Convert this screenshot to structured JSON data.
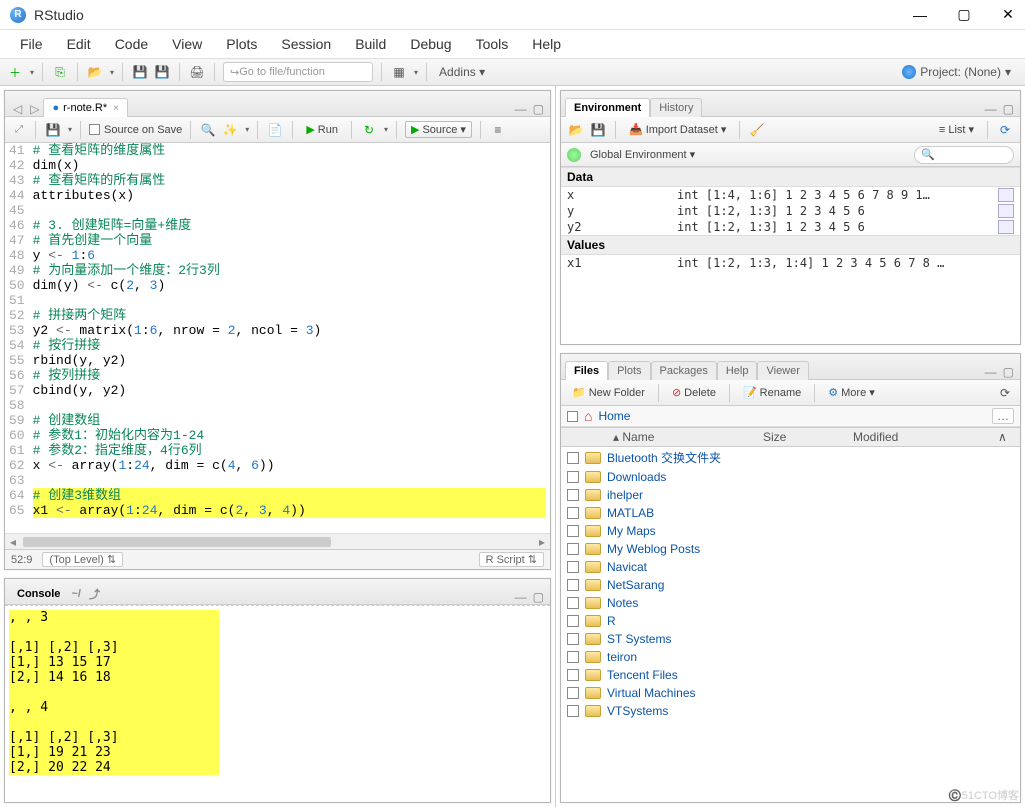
{
  "window": {
    "title": "RStudio"
  },
  "menu": [
    "File",
    "Edit",
    "Code",
    "View",
    "Plots",
    "Session",
    "Build",
    "Debug",
    "Tools",
    "Help"
  ],
  "toolbar": {
    "goto_placeholder": "Go to file/function",
    "addins": "Addins",
    "project": "Project: (None)"
  },
  "editor": {
    "tab": "r-note.R*",
    "sourceOnSave": "Source on Save",
    "run": "Run",
    "source": "Source",
    "status_pos": "52:9",
    "status_level": "(Top Level)",
    "status_lang": "R Script",
    "lines": [
      {
        "n": 41,
        "seg": [
          {
            "c": "c-comment",
            "t": "# 查看矩阵的维度属性"
          }
        ]
      },
      {
        "n": 42,
        "seg": [
          {
            "c": "",
            "t": "dim(x)"
          }
        ]
      },
      {
        "n": 43,
        "seg": [
          {
            "c": "c-comment",
            "t": "# 查看矩阵的所有属性"
          }
        ]
      },
      {
        "n": 44,
        "seg": [
          {
            "c": "",
            "t": "attributes(x)"
          }
        ]
      },
      {
        "n": 45,
        "seg": [
          {
            "c": "",
            "t": ""
          }
        ]
      },
      {
        "n": 46,
        "seg": [
          {
            "c": "c-comment",
            "t": "# 3. 创建矩阵=向量+维度"
          }
        ]
      },
      {
        "n": 47,
        "seg": [
          {
            "c": "c-comment",
            "t": "# 首先创建一个向量"
          }
        ]
      },
      {
        "n": 48,
        "seg": [
          {
            "c": "",
            "t": "y "
          },
          {
            "c": "c-op",
            "t": "<- "
          },
          {
            "c": "c-num",
            "t": "1"
          },
          {
            "c": "",
            "t": ":"
          },
          {
            "c": "c-num",
            "t": "6"
          }
        ]
      },
      {
        "n": 49,
        "seg": [
          {
            "c": "c-comment",
            "t": "# 为向量添加一个维度：2行3列"
          }
        ]
      },
      {
        "n": 50,
        "seg": [
          {
            "c": "",
            "t": "dim(y) "
          },
          {
            "c": "c-op",
            "t": "<- "
          },
          {
            "c": "",
            "t": "c("
          },
          {
            "c": "c-num",
            "t": "2"
          },
          {
            "c": "",
            "t": ", "
          },
          {
            "c": "c-num",
            "t": "3"
          },
          {
            "c": "",
            "t": ")"
          }
        ]
      },
      {
        "n": 51,
        "seg": [
          {
            "c": "",
            "t": ""
          }
        ]
      },
      {
        "n": 52,
        "seg": [
          {
            "c": "c-comment",
            "t": "# 拼接两个矩阵"
          }
        ]
      },
      {
        "n": 53,
        "seg": [
          {
            "c": "",
            "t": "y2 "
          },
          {
            "c": "c-op",
            "t": "<- "
          },
          {
            "c": "",
            "t": "matrix("
          },
          {
            "c": "c-num",
            "t": "1"
          },
          {
            "c": "",
            "t": ":"
          },
          {
            "c": "c-num",
            "t": "6"
          },
          {
            "c": "",
            "t": ", nrow = "
          },
          {
            "c": "c-num",
            "t": "2"
          },
          {
            "c": "",
            "t": ", ncol = "
          },
          {
            "c": "c-num",
            "t": "3"
          },
          {
            "c": "",
            "t": ")"
          }
        ]
      },
      {
        "n": 54,
        "seg": [
          {
            "c": "c-comment",
            "t": "# 按行拼接"
          }
        ]
      },
      {
        "n": 55,
        "seg": [
          {
            "c": "",
            "t": "rbind(y, y2)"
          }
        ]
      },
      {
        "n": 56,
        "seg": [
          {
            "c": "c-comment",
            "t": "# 按列拼接"
          }
        ]
      },
      {
        "n": 57,
        "seg": [
          {
            "c": "",
            "t": "cbind(y, y2)"
          }
        ]
      },
      {
        "n": 58,
        "seg": [
          {
            "c": "",
            "t": ""
          }
        ]
      },
      {
        "n": 59,
        "seg": [
          {
            "c": "c-comment",
            "t": "# 创建数组"
          }
        ]
      },
      {
        "n": 60,
        "seg": [
          {
            "c": "c-comment",
            "t": "# 参数1：初始化内容为1-24"
          }
        ]
      },
      {
        "n": 61,
        "seg": [
          {
            "c": "c-comment",
            "t": "# 参数2：指定维度，4行6列"
          }
        ]
      },
      {
        "n": 62,
        "seg": [
          {
            "c": "",
            "t": "x "
          },
          {
            "c": "c-op",
            "t": "<- "
          },
          {
            "c": "",
            "t": "array("
          },
          {
            "c": "c-num",
            "t": "1"
          },
          {
            "c": "",
            "t": ":"
          },
          {
            "c": "c-num",
            "t": "24"
          },
          {
            "c": "",
            "t": ", dim = c("
          },
          {
            "c": "c-num",
            "t": "4"
          },
          {
            "c": "",
            "t": ", "
          },
          {
            "c": "c-num",
            "t": "6"
          },
          {
            "c": "",
            "t": "))"
          }
        ]
      },
      {
        "n": 63,
        "seg": [
          {
            "c": "",
            "t": ""
          }
        ]
      },
      {
        "n": 64,
        "hl": true,
        "seg": [
          {
            "c": "c-comment",
            "t": "# 创建3维数组"
          }
        ]
      },
      {
        "n": 65,
        "hl": true,
        "seg": [
          {
            "c": "",
            "t": "x1 "
          },
          {
            "c": "c-op",
            "t": "<- "
          },
          {
            "c": "",
            "t": "array("
          },
          {
            "c": "c-num",
            "t": "1"
          },
          {
            "c": "",
            "t": ":"
          },
          {
            "c": "c-num",
            "t": "24"
          },
          {
            "c": "",
            "t": ", dim = c("
          },
          {
            "c": "c-num",
            "t": "2"
          },
          {
            "c": "",
            "t": ", "
          },
          {
            "c": "c-num",
            "t": "3"
          },
          {
            "c": "",
            "t": ", "
          },
          {
            "c": "c-num",
            "t": "4"
          },
          {
            "c": "",
            "t": "))"
          }
        ]
      }
    ]
  },
  "console": {
    "title": "Console",
    "path": "~/",
    "lines": [
      ", , 3",
      "",
      "     [,1] [,2] [,3]",
      "[1,]   13   15   17",
      "[2,]   14   16   18",
      "",
      ", , 4",
      "",
      "     [,1] [,2] [,3]",
      "[1,]   19   21   23",
      "[2,]   20   22   24"
    ]
  },
  "env": {
    "tabs": [
      "Environment",
      "History"
    ],
    "importLabel": "Import Dataset",
    "listLabel": "List",
    "scopeLabel": "Global Environment",
    "sections": [
      {
        "header": "Data",
        "rows": [
          {
            "name": "x",
            "value": "int [1:4, 1:6] 1 2 3 4 5 6 7 8 9 1…",
            "grid": true
          },
          {
            "name": "y",
            "value": "int [1:2, 1:3] 1 2 3 4 5 6",
            "grid": true
          },
          {
            "name": "y2",
            "value": "int [1:2, 1:3] 1 2 3 4 5 6",
            "grid": true
          }
        ]
      },
      {
        "header": "Values",
        "rows": [
          {
            "name": "x1",
            "value": "int [1:2, 1:3, 1:4] 1 2 3 4 5 6 7 8 …",
            "grid": false
          }
        ]
      }
    ]
  },
  "files": {
    "tabs": [
      "Files",
      "Plots",
      "Packages",
      "Help",
      "Viewer"
    ],
    "newFolder": "New Folder",
    "delete": "Delete",
    "rename": "Rename",
    "more": "More",
    "home": "Home",
    "cols": {
      "name": "Name",
      "size": "Size",
      "modified": "Modified"
    },
    "items": [
      "Bluetooth 交换文件夹",
      "Downloads",
      "ihelper",
      "MATLAB",
      "My Maps",
      "My Weblog Posts",
      "Navicat",
      "NetSarang",
      "Notes",
      "R",
      "ST Systems",
      "teiron",
      "Tencent Files",
      "Virtual Machines",
      "VTSystems"
    ]
  },
  "watermark": "©️51CTO博客"
}
